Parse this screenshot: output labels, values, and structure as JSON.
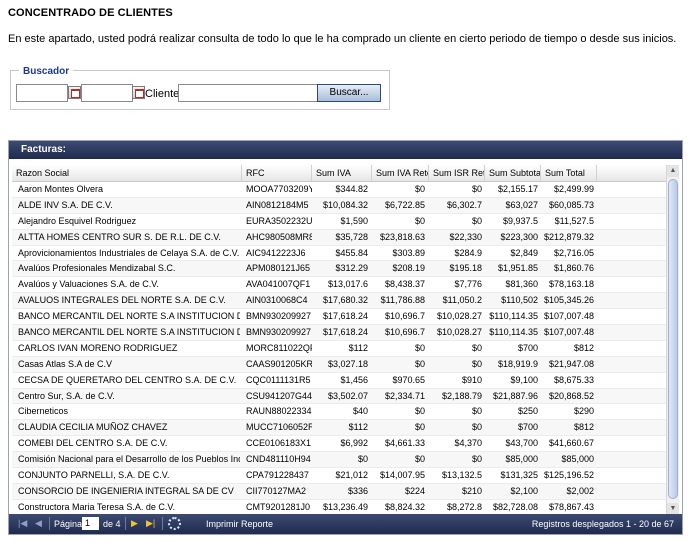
{
  "page": {
    "title": "CONCENTRADO DE CLIENTES",
    "intro": "En este apartado, usted podrá realizar consulta de todo lo que le ha comprado un cliente en cierto periodo de tiempo o desde sus inicios."
  },
  "search": {
    "legend": "Buscador",
    "client_label": "Cliente:",
    "button_label": "Buscar..."
  },
  "grid": {
    "title": "Facturas:",
    "columns": [
      "Razon Social",
      "RFC",
      "Sum IVA",
      "Sum IVA Rete",
      "Sum ISR Rete",
      "Sum Subtotal",
      "Sum Total"
    ],
    "rows": [
      [
        "Aaron Montes Olvera",
        "MOOA7703209Y5",
        "$344.82",
        "$0",
        "$0",
        "$2,155.17",
        "$2,499.99"
      ],
      [
        "ALDE INV S.A. DE C.V.",
        "AIN0812184M5",
        "$10,084.32",
        "$6,722.85",
        "$6,302.7",
        "$63,027",
        "$60,085.73"
      ],
      [
        "Alejandro Esquivel Rodriguez",
        "EURA3502232U2",
        "$1,590",
        "$0",
        "$0",
        "$9,937.5",
        "$11,527.5"
      ],
      [
        "ALTTA HOMES CENTRO SUR S. DE R.L. DE C.V.",
        "AHC980508MR8",
        "$35,728",
        "$23,818.63",
        "$22,330",
        "$223,300",
        "$212,879.32"
      ],
      [
        "Aprovicionamientos Industriales de Celaya S.A. de C.V.",
        "AIC9412223J6",
        "$455.84",
        "$303.89",
        "$284.9",
        "$2,849",
        "$2,716.05"
      ],
      [
        "Avalúos Profesionales Mendizabal S.C.",
        "APM080121J65",
        "$312.29",
        "$208.19",
        "$195.18",
        "$1,951.85",
        "$1,860.76"
      ],
      [
        "Avalúos y Valuaciones S.A. de C.V.",
        "AVA041007QF1",
        "$13,017.6",
        "$8,438.37",
        "$7,776",
        "$81,360",
        "$78,163.18"
      ],
      [
        "AVALUOS INTEGRALES DEL NORTE S.A. DE C.V.",
        "AIN0310068C4",
        "$17,680.32",
        "$11,786.88",
        "$11,050.2",
        "$110,502",
        "$105,345.26"
      ],
      [
        "BANCO MERCANTIL DEL NORTE S.A INSTITUCION DE BAN...",
        "BMN930209927",
        "$17,618.24",
        "$10,696.7",
        "$10,028.27",
        "$110,114.35",
        "$107,007.48"
      ],
      [
        "BANCO MERCANTIL DEL NORTE S.A INSTITUCION DE BAN...",
        "BMN930209927",
        "$17,618.24",
        "$10,696.7",
        "$10,028.27",
        "$110,114.35",
        "$107,007.48"
      ],
      [
        "CARLOS IVAN MORENO RODRIGUEZ",
        "MORC811022QF2",
        "$112",
        "$0",
        "$0",
        "$700",
        "$812"
      ],
      [
        "Casas Atlas S.A de C.V",
        "CAAS901205KRT",
        "$3,027.18",
        "$0",
        "$0",
        "$18,919.9",
        "$21,947.08"
      ],
      [
        "CECSA DE QUERETARO DEL CENTRO S.A. DE C.V.",
        "CQC0111131R5",
        "$1,456",
        "$970.65",
        "$910",
        "$9,100",
        "$8,675.33"
      ],
      [
        "Centro Sur, S.A. de C.V.",
        "CSU941207G44",
        "$3,502.07",
        "$2,334.71",
        "$2,188.79",
        "$21,887.96",
        "$20,868.52"
      ],
      [
        "Ciberneticos",
        "RAUN880223345",
        "$40",
        "$0",
        "$0",
        "$250",
        "$290"
      ],
      [
        "CLAUDIA CECILIA MUÑOZ CHAVEZ",
        "MUCC7106052R1",
        "$112",
        "$0",
        "$0",
        "$700",
        "$812"
      ],
      [
        "COMEBI DEL CENTRO S.A. DE C.V.",
        "CCE0106183X1",
        "$6,992",
        "$4,661.33",
        "$4,370",
        "$43,700",
        "$41,660.67"
      ],
      [
        "Comisión Nacional para el Desarrollo de los Pueblos Indige...",
        "CND481110H94",
        "$0",
        "$0",
        "$0",
        "$85,000",
        "$85,000"
      ],
      [
        "CONJUNTO PARNELLI, S.A. DE C.V.",
        "CPA791228437",
        "$21,012",
        "$14,007.95",
        "$13,132.5",
        "$131,325",
        "$125,196.52"
      ],
      [
        "CONSORCIO DE INGENIERIA INTEGRAL SA DE CV",
        "CII770127MA2",
        "$336",
        "$224",
        "$210",
        "$2,100",
        "$2,002"
      ],
      [
        "Constructora Maria Teresa S.A. de C.V.",
        "CMT9201281J0",
        "$13,236.49",
        "$8,824.32",
        "$8,272.8",
        "$82,728.08",
        "$78,867.43"
      ]
    ]
  },
  "pager": {
    "page_label": "Página",
    "page_value": "1",
    "of_label": "de 4",
    "print_label": "Imprimir Reporte",
    "records_label": "Registros desplegados 1 - 20 de 67",
    "icons": [
      "first-page-icon",
      "prev-page-icon",
      "next-page-icon",
      "last-page-icon",
      "refresh-icon"
    ]
  }
}
